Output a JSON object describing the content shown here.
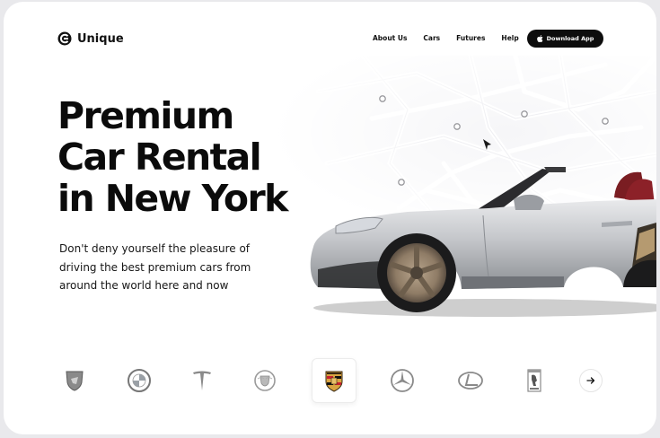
{
  "header": {
    "brand_name": "Unique",
    "nav": [
      "About Us",
      "Cars",
      "Futures",
      "Help"
    ],
    "download_label": "Download App"
  },
  "hero": {
    "title_lines": [
      "Premium",
      "Car Rental",
      "in New York"
    ],
    "subtitle_lines": [
      "Don't deny yourself the pleasure of",
      "driving the best premium cars from",
      "around the world here and now"
    ]
  },
  "brands": {
    "items": [
      "lamborghini-icon",
      "bmw-icon",
      "tesla-icon",
      "cadillac-icon",
      "porsche-icon",
      "mercedes-icon",
      "lexus-icon",
      "ferrari-icon"
    ],
    "selected": "porsche-icon"
  },
  "colors": {
    "accent": "#0d0d0d",
    "background": "#ffffff",
    "porsche_red": "#c8202f",
    "porsche_gold": "#d9a441"
  }
}
